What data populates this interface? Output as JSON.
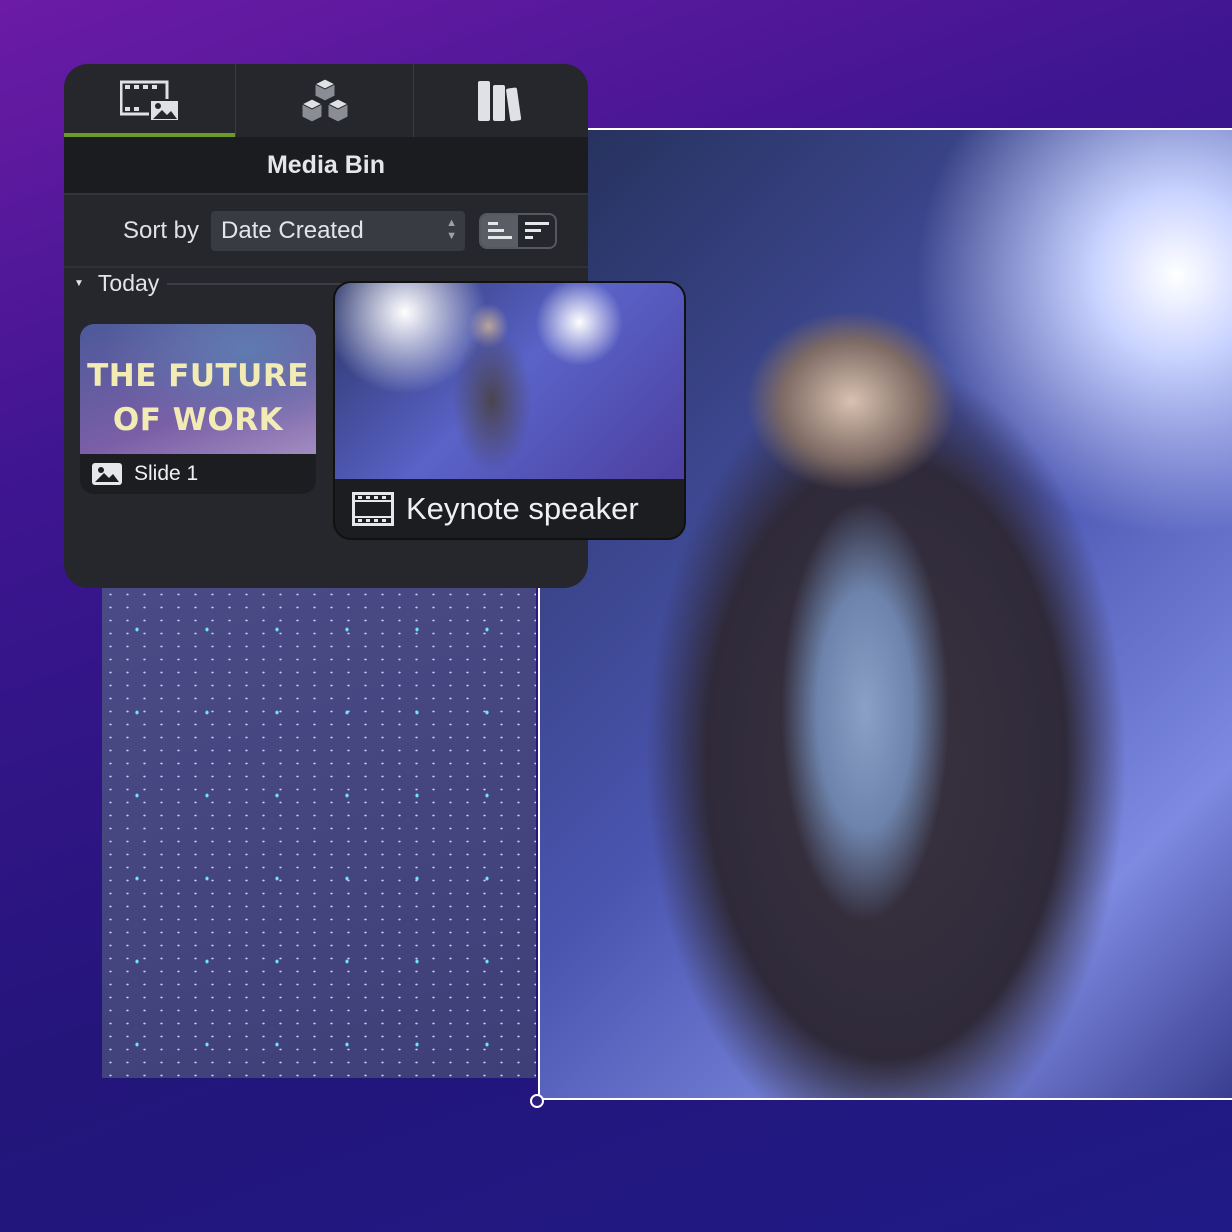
{
  "tabs": [
    {
      "icon": "media-icon",
      "active": true
    },
    {
      "icon": "library-cubes-icon",
      "active": false
    },
    {
      "icon": "books-icon",
      "active": false
    }
  ],
  "panel": {
    "title": "Media Bin",
    "sort_label": "Sort by",
    "sort_value": "Date Created",
    "group": "Today"
  },
  "items": [
    {
      "title_text": [
        "THE FUTURE",
        "OF WORK"
      ],
      "label": "Slide 1",
      "icon": "image-icon"
    },
    {
      "label": "Keynote speaker",
      "icon": "film-icon"
    }
  ],
  "colors": {
    "active_tab": "#6b9a2a",
    "panel_bg": "#25272d"
  }
}
